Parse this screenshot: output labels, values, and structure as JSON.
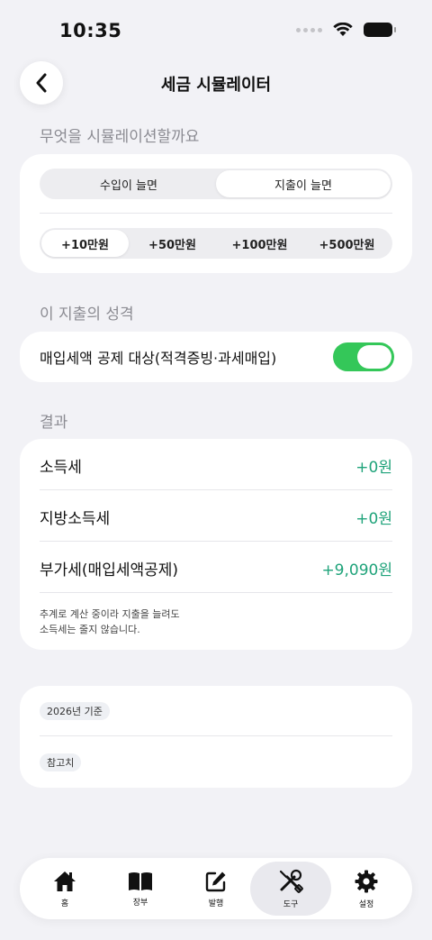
{
  "status_bar": {
    "time": "10:35"
  },
  "header": {
    "title": "세금 시뮬레이터"
  },
  "simulate_section": {
    "label": "무엇을 시뮬레이션할까요",
    "mode_options": [
      "수입이 늘면",
      "지출이 늘면"
    ],
    "selected_mode": "지출이 늘면",
    "amount_options": [
      "+10만원",
      "+50만원",
      "+100만원",
      "+500만원"
    ],
    "selected_amount": "+10만원"
  },
  "expense_section": {
    "label": "이 지출의 성격",
    "toggle_label": "매입세액 공제 대상(적격증빙·과세매입)",
    "toggle_on": true
  },
  "result_section": {
    "label": "결과",
    "rows": [
      {
        "name": "소득세",
        "value": "+0원"
      },
      {
        "name": "지방소득세",
        "value": "+0원"
      },
      {
        "name": "부가세(매입세액공제)",
        "value": "+9,090원"
      }
    ],
    "note_line1": "추계로 계산 중이라 지출을 늘려도",
    "note_line2": "소득세는 줄지 않습니다."
  },
  "reference_card": {
    "basis_chip": "2026년 기준",
    "reference_chip": "참고치"
  },
  "tab_bar": {
    "tabs": [
      {
        "label": "홈",
        "icon": "home-icon"
      },
      {
        "label": "장부",
        "icon": "book-icon"
      },
      {
        "label": "발행",
        "icon": "edit-icon"
      },
      {
        "label": "도구",
        "icon": "tools-icon"
      },
      {
        "label": "설정",
        "icon": "gear-icon"
      }
    ],
    "active": "도구"
  },
  "colors": {
    "accent_green": "#34c759",
    "positive_value": "#1fa37a",
    "background": "#f2f2f6"
  }
}
